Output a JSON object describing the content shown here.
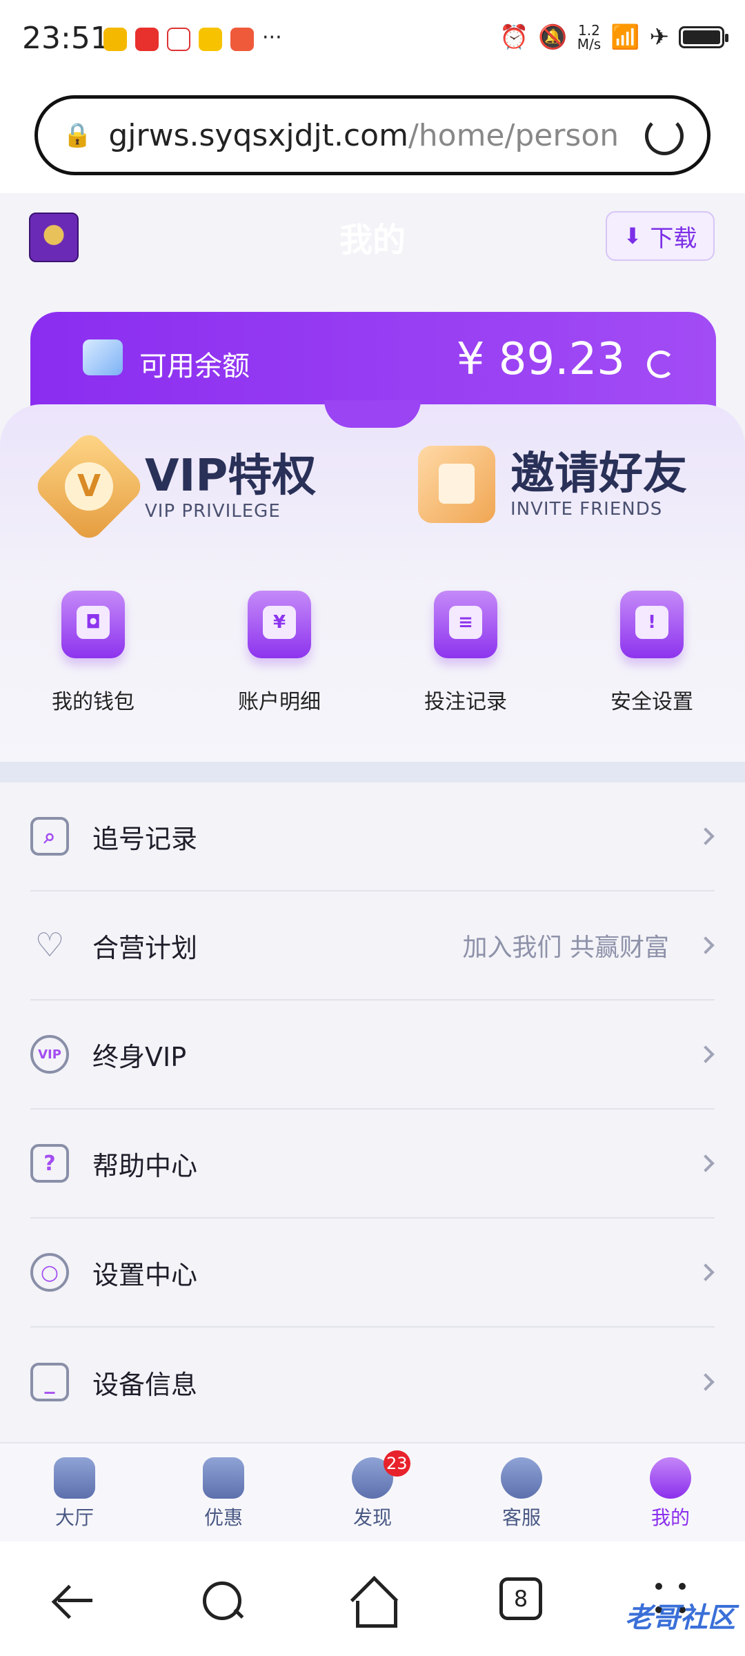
{
  "status_bar": {
    "time": "23:51",
    "more": "···",
    "net_speed_value": "1.2",
    "net_speed_unit": "M/s"
  },
  "browser": {
    "url_domain": "gjrws.syqsxjdjt.com",
    "url_path": "/home/person",
    "tab_count": "8"
  },
  "header": {
    "title": "我的",
    "download_label": "下载"
  },
  "balance": {
    "label": "可用余额",
    "amount": "¥ 89.23"
  },
  "promos": [
    {
      "title": "VIP特权",
      "subtitle": "VIP PRIVILEGE",
      "icon": "vip-badge-icon"
    },
    {
      "title": "邀请好友",
      "subtitle": "INVITE FRIENDS",
      "icon": "invite-friends-icon"
    }
  ],
  "shortcuts": [
    {
      "label": "我的钱包",
      "icon": "wallet-icon"
    },
    {
      "label": "账户明细",
      "icon": "account-detail-icon"
    },
    {
      "label": "投注记录",
      "icon": "bet-record-icon"
    },
    {
      "label": "安全设置",
      "icon": "security-shield-icon"
    }
  ],
  "menu": [
    {
      "label": "追号记录",
      "extra": "",
      "icon": "search-record-icon"
    },
    {
      "label": "合营计划",
      "extra": "加入我们 共赢财富",
      "icon": "partner-heart-icon"
    },
    {
      "label": "终身VIP",
      "extra": "",
      "icon": "vip-user-icon"
    },
    {
      "label": "帮助中心",
      "extra": "",
      "icon": "help-icon"
    },
    {
      "label": "设置中心",
      "extra": "",
      "icon": "settings-gear-icon"
    },
    {
      "label": "设备信息",
      "extra": "",
      "icon": "device-icon"
    }
  ],
  "tabs": [
    {
      "label": "大厅",
      "icon": "home-icon",
      "active": false
    },
    {
      "label": "优惠",
      "icon": "star-icon",
      "active": false
    },
    {
      "label": "发现",
      "icon": "discover-icon",
      "active": false,
      "badge": "23"
    },
    {
      "label": "客服",
      "icon": "service-icon",
      "active": false
    },
    {
      "label": "我的",
      "icon": "profile-icon",
      "active": true
    }
  ],
  "watermark": "老哥社区",
  "colors": {
    "accent": "#8b30ec",
    "badge_red": "#e8222c"
  }
}
